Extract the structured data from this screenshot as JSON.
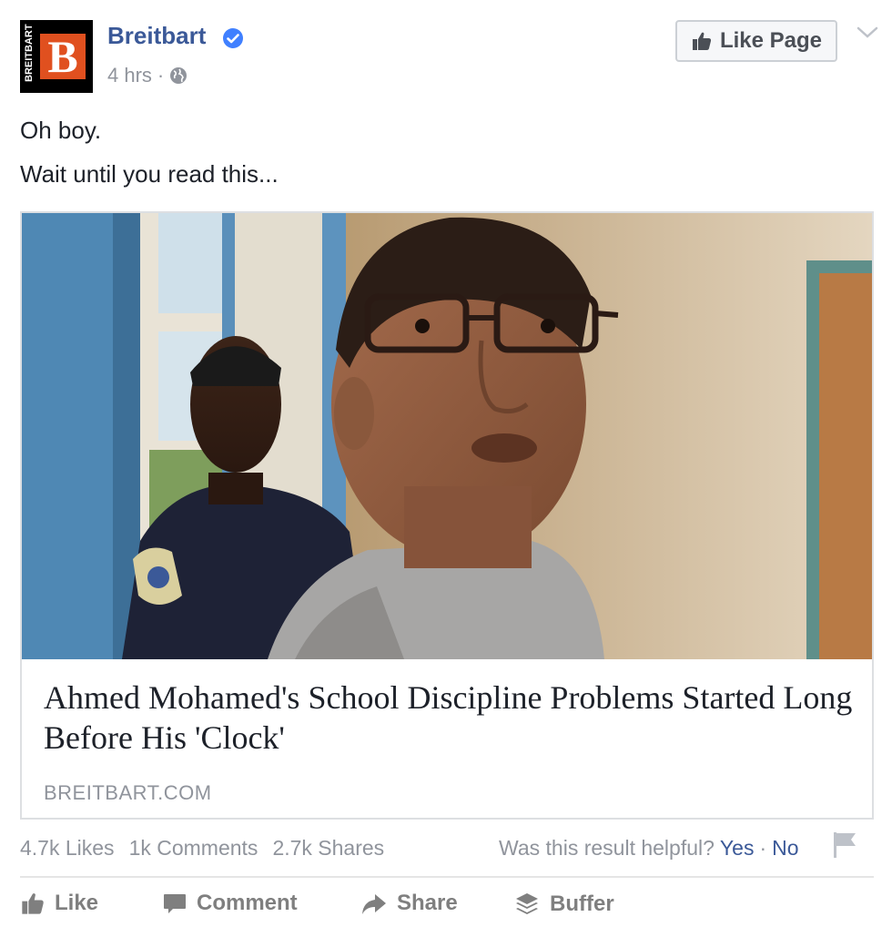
{
  "post": {
    "page_name": "Breitbart",
    "logo_vertical_text": "BREITBART",
    "logo_letter": "B",
    "time": "4 hrs",
    "separator": "·",
    "like_page_label": "Like Page",
    "text_line_1": "Oh boy.",
    "text_line_2": "Wait until you read this..."
  },
  "link_card": {
    "title": "Ahmed Mohamed's School Discipline Problems Started Long Before His 'Clock'",
    "domain": "BREITBART.COM"
  },
  "stats": {
    "likes": "4.7k Likes",
    "comments": "1k Comments",
    "shares": "2.7k Shares"
  },
  "helpful": {
    "question": "Was this result helpful?",
    "yes": "Yes",
    "separator": "·",
    "no": "No"
  },
  "actions": {
    "like": "Like",
    "comment": "Comment",
    "share": "Share",
    "buffer": "Buffer"
  },
  "colors": {
    "facebook_blue": "#3b5998",
    "verified_blue": "#4080ff",
    "breitbart_orange": "#e0501f",
    "muted_gray": "#90949c"
  },
  "icons": {
    "verified": "verified-badge-icon",
    "globe": "globe-icon",
    "thumbs_up": "thumbs-up-icon",
    "chevron": "chevron-down-icon",
    "flag": "flag-icon",
    "comment": "comment-bubble-icon",
    "share": "share-arrow-icon",
    "buffer": "buffer-stack-icon"
  }
}
